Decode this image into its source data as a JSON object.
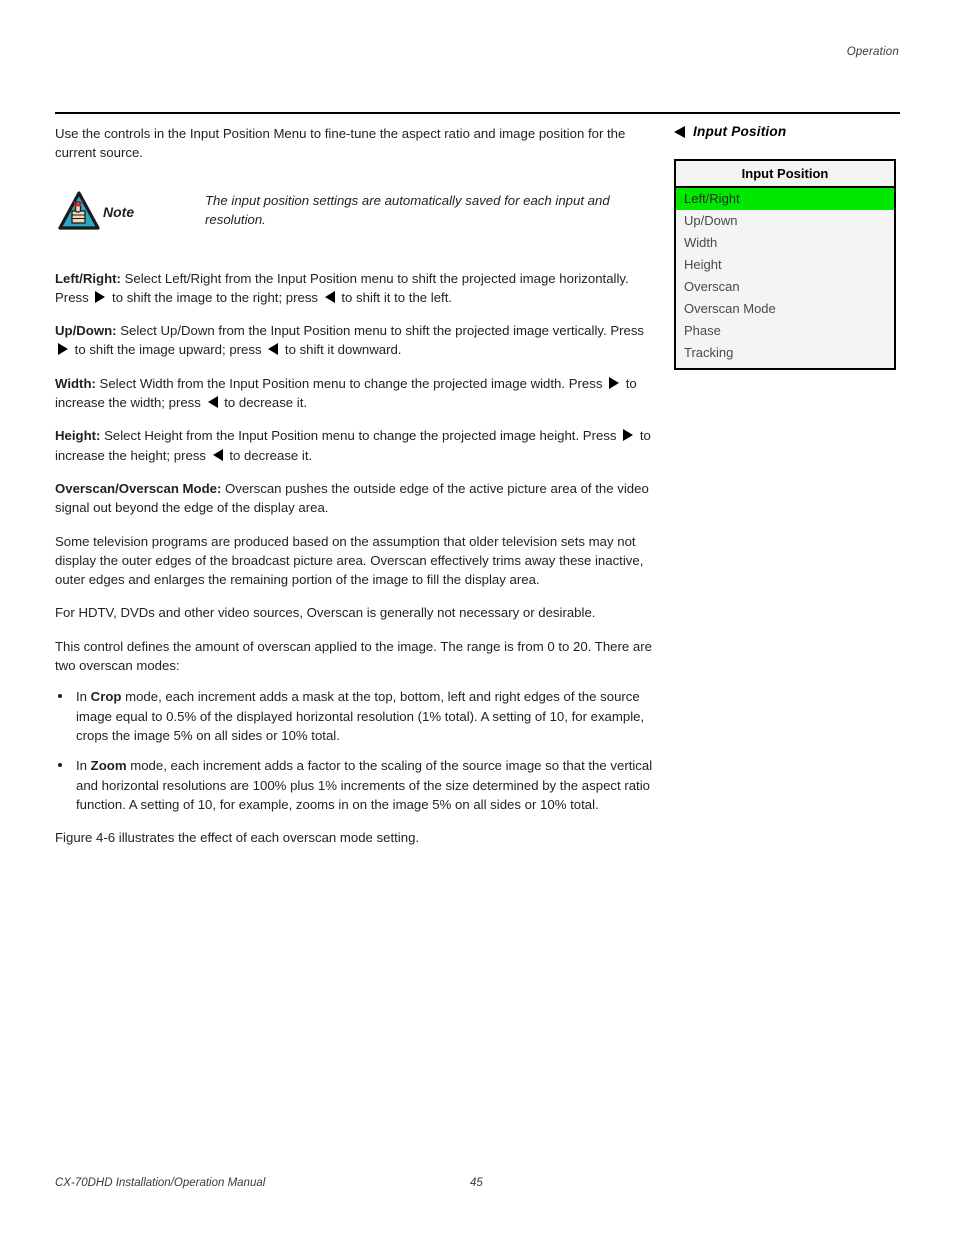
{
  "header": {
    "running_head": "Operation"
  },
  "footer": {
    "manual_title": "CX-70DHD Installation/Operation Manual",
    "page_number": "45"
  },
  "body": {
    "intro": "Use the controls in the Input Position Menu to fine-tune the aspect ratio and image position for the current source.",
    "note": {
      "label": "Note",
      "icon": "note-triangle-hand-icon",
      "text": "The input position settings are automatically saved for each input and resolution."
    },
    "entries": [
      {
        "term": "Left/Right:",
        "part1": " Select Left/Right from the Input Position menu to shift the projected image horizontally. Press ",
        "part2": " to shift the image to the right; press ",
        "part3": " to shift it to the left."
      },
      {
        "term": "Up/Down:",
        "part1": " Select Up/Down from the Input Position menu to shift the projected image vertically. Press ",
        "part2": " to shift the image upward; press ",
        "part3": " to shift it downward."
      },
      {
        "term": "Width:",
        "part1": " Select Width from the Input Position menu to change the projected image width. Press ",
        "part2": " to increase the width; press ",
        "part3": " to decrease it."
      },
      {
        "term": "Height:",
        "part1": " Select Height from the Input Position menu to change the projected image height. Press ",
        "part2": " to increase the height; press ",
        "part3": " to decrease it."
      }
    ],
    "overscan_term": "Overscan/Overscan Mode:",
    "overscan_text": " Overscan pushes the outside edge of the active picture area of the video signal out beyond the edge of the display area.",
    "para_tv": "Some television programs are produced based on the assumption that older television sets may not display the outer edges of the broadcast picture area. Overscan effectively trims away these inactive, outer edges and enlarges the remaining portion of the image to fill the display area.",
    "para_hdtv": "For HDTV, DVDs and other video sources, Overscan is generally not necessary or desirable.",
    "para_range": "This control defines the amount of overscan applied to the image. The range is from 0 to 20. There are two overscan modes:",
    "bullets": [
      {
        "pre": "In ",
        "bold": "Crop",
        "post": " mode, each increment adds a mask at the top, bottom, left and right edges of the source image equal to 0.5% of the displayed horizontal resolution (1% total). A setting of 10, for example, crops the image 5% on all sides or 10% total."
      },
      {
        "pre": "In ",
        "bold": "Zoom",
        "post": " mode, each increment adds a factor to the scaling of the source image so that the vertical and horizontal resolutions are 100% plus 1% increments of the size determined by the aspect ratio function. A setting of 10, for example, zooms in on the image 5% on all sides or 10% total."
      }
    ],
    "figure_ref": "Figure 4-6 illustrates the effect of each overscan mode setting."
  },
  "sidebar": {
    "heading": "Input Position",
    "heading_icon": "back-arrow-icon",
    "menu": {
      "title": "Input Position",
      "items": [
        {
          "label": "Left/Right",
          "selected": true
        },
        {
          "label": "Up/Down",
          "selected": false
        },
        {
          "label": "Width",
          "selected": false
        },
        {
          "label": "Height",
          "selected": false
        },
        {
          "label": "Overscan",
          "selected": false
        },
        {
          "label": "Overscan Mode",
          "selected": false
        },
        {
          "label": "Phase",
          "selected": false
        },
        {
          "label": "Tracking",
          "selected": false
        }
      ],
      "highlight_color": "#00e800",
      "background_color": "#f4f4f4",
      "border_color": "#000000"
    }
  }
}
